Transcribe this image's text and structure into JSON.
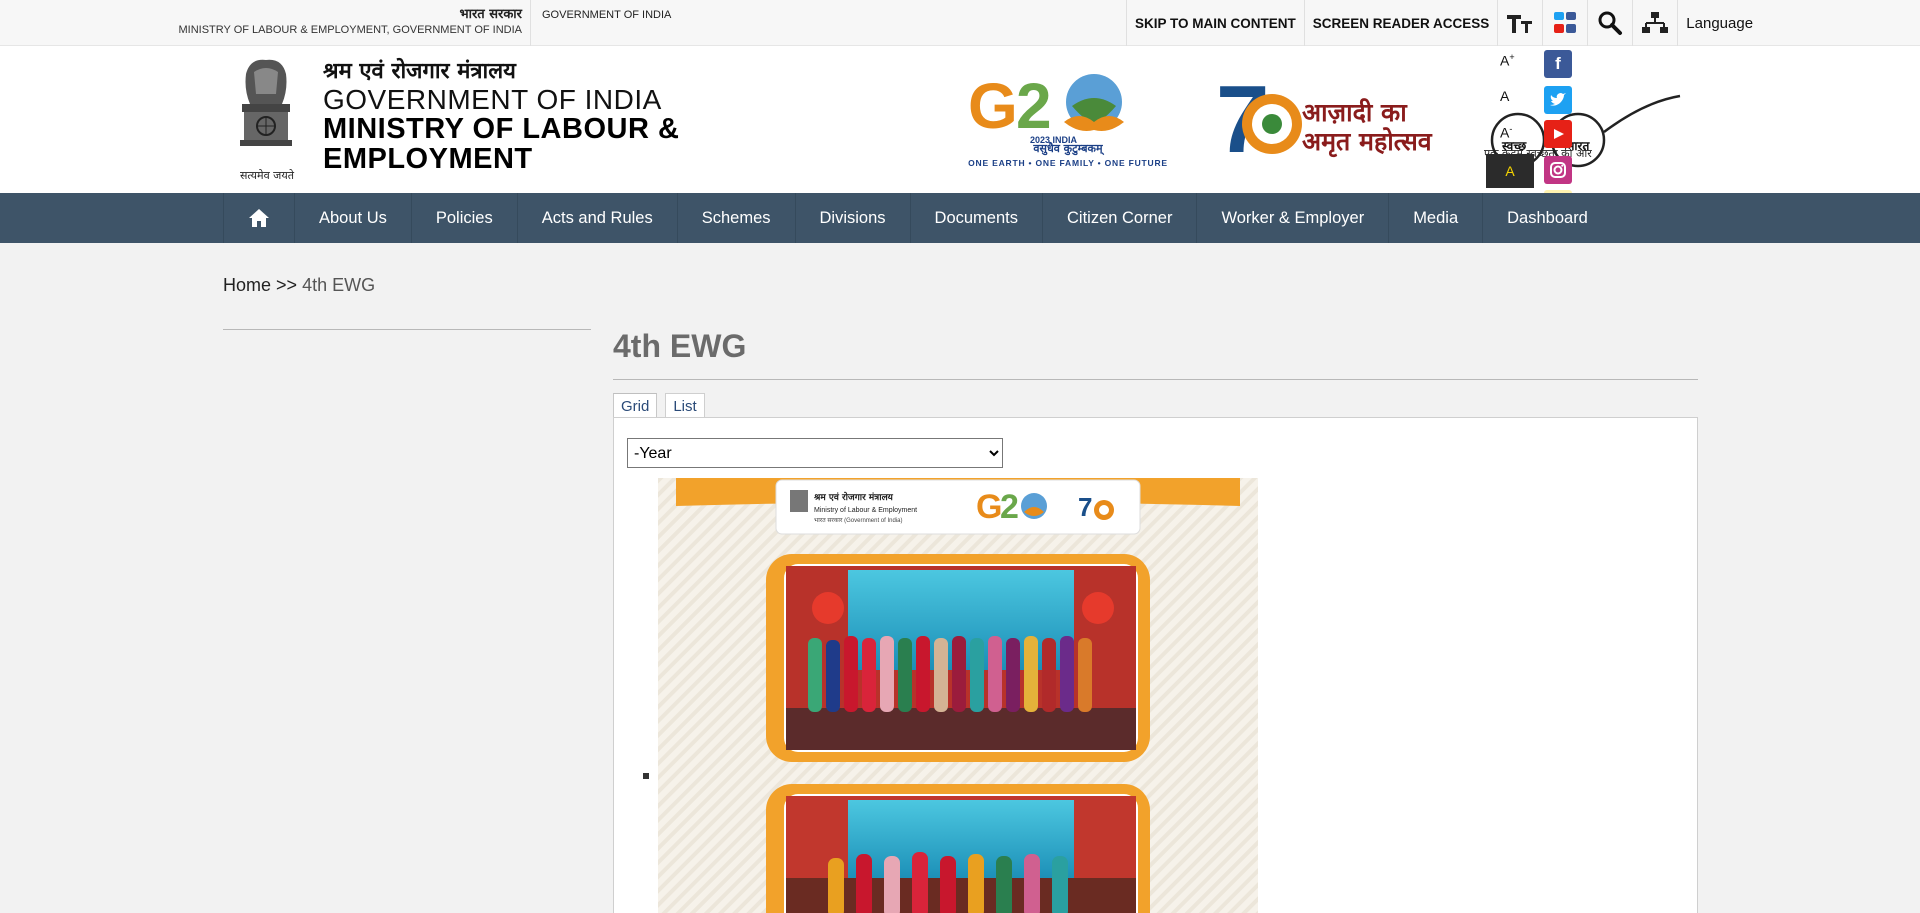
{
  "topbar": {
    "gov_hindi": "भारत सरकार",
    "gov_english": "MINISTRY OF LABOUR & EMPLOYMENT, GOVERNMENT OF INDIA",
    "gov_india": "GOVERNMENT OF INDIA",
    "skip_link": "SKIP TO MAIN CONTENT",
    "screen_reader": "SCREEN READER ACCESS",
    "language": "Language"
  },
  "header": {
    "ministry_hindi": "श्रम एवं रोजगार मंत्रालय",
    "gov_of_india": "GOVERNMENT OF INDIA",
    "ministry_name": "MINISTRY OF LABOUR & EMPLOYMENT",
    "emblem_motto": "सत्यमेव जयते",
    "g20_hindi": "वसुधैव कुटुम्बकम्",
    "g20_tagline": "ONE EARTH • ONE FAMILY • ONE FUTURE",
    "g20_year": "2023 INDIA",
    "azadi_hindi_1": "आज़ादी का",
    "azadi_hindi_2": "अमृत महोत्सव",
    "swachh_1": "स्वच्छ",
    "swachh_2": "भारत",
    "swachh_tagline": "एक कदम स्वच्छता की ओर",
    "font_increase": "A+",
    "font_normal": "A",
    "font_decrease": "A-",
    "contrast": "A"
  },
  "nav": {
    "items": [
      "About Us",
      "Policies",
      "Acts and Rules",
      "Schemes",
      "Divisions",
      "Documents",
      "Citizen Corner",
      "Worker & Employer",
      "Media",
      "Dashboard"
    ]
  },
  "breadcrumb": {
    "home": "Home",
    "sep": ">>",
    "current": "4th EWG"
  },
  "main": {
    "title": "4th EWG",
    "tabs": [
      "Grid",
      "List"
    ],
    "year_select": "-Year"
  },
  "poster": {
    "hindi": "श्रम एवं रोजगार मंत्रालय",
    "ministry": "Ministry of Labour & Employment",
    "gov": "भारत सरकार (Government of India)"
  },
  "colors": {
    "nav_bg": "#3e5468",
    "title": "#6b6b6b",
    "g20_blue": "#1b3f86",
    "azadi_red": "#8a1c1c",
    "facebook": "#3b5998",
    "twitter": "#1da1f2",
    "youtube": "#e62117",
    "instagram": "#c13584"
  },
  "icons": [
    "text-size-icon",
    "social-media-icon",
    "search-icon",
    "sitemap-icon",
    "home-icon",
    "facebook-icon",
    "twitter-icon",
    "youtube-icon",
    "instagram-icon",
    "koo-icon"
  ]
}
